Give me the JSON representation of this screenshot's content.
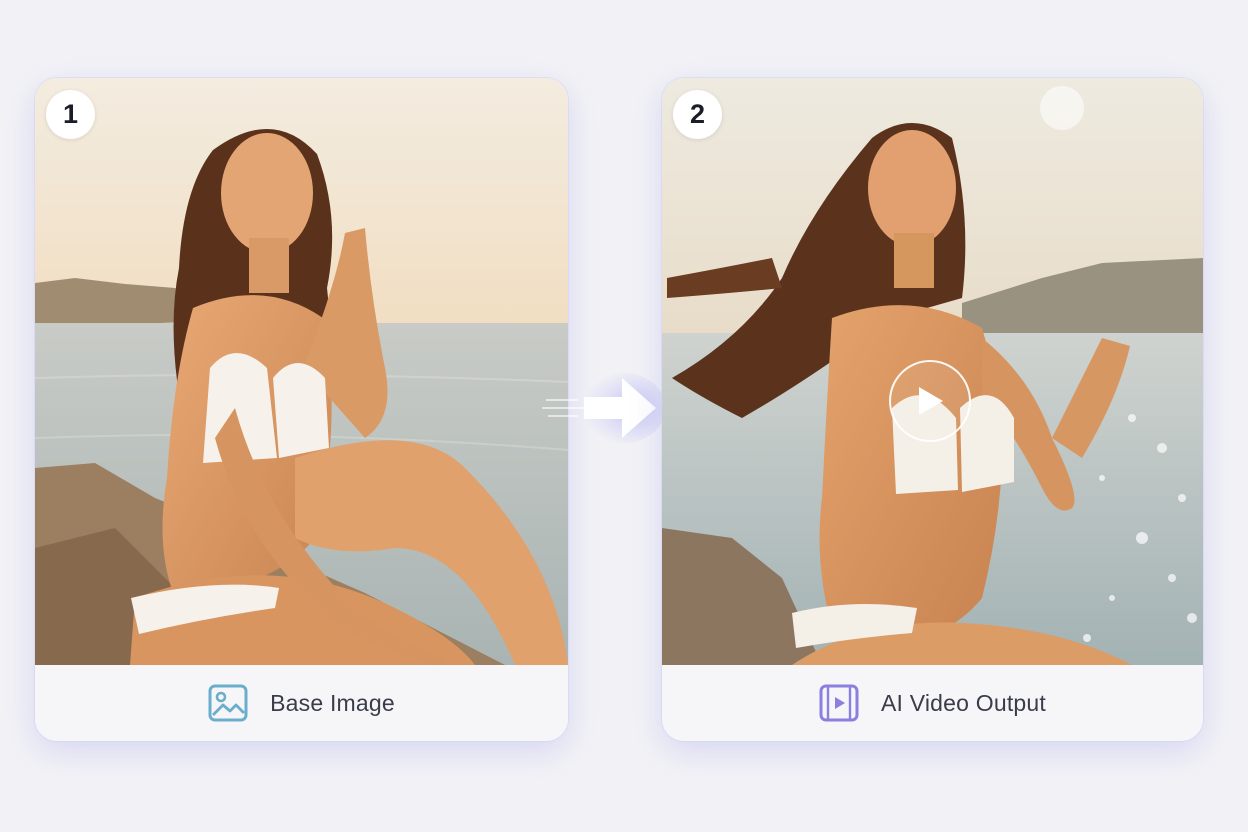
{
  "steps": [
    {
      "number": "1",
      "label": "Base Image",
      "icon": "image-icon",
      "image": "woman in white bikini seated on rocks by the sea at sunset"
    },
    {
      "number": "2",
      "label": "AI Video Output",
      "icon": "video-icon",
      "image": "same woman with hair blowing in wind, video frame",
      "overlay": "play-icon"
    }
  ],
  "connector": {
    "icon": "arrow-right-icon"
  },
  "colors": {
    "background": "#f2f2f6",
    "card": "#f6f6f9",
    "card_glow": "#9a9ae8",
    "image_icon": "#6aaecb",
    "video_icon": "#8b7fe0",
    "label_text": "#3a3c4a"
  }
}
